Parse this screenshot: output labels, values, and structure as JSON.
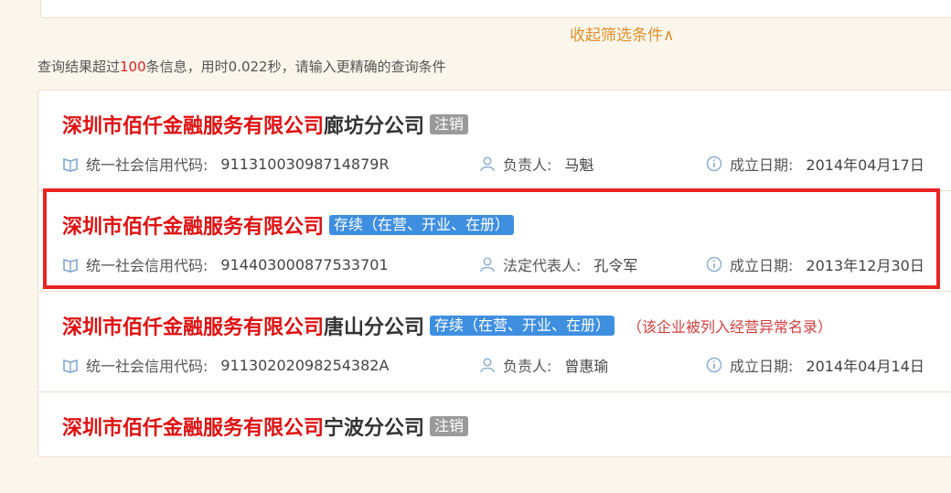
{
  "filter": {
    "collapse_label": "收起筛选条件∧"
  },
  "summary": {
    "prefix": "查询结果超过",
    "count": "100",
    "suffix": "条信息，用时0.022秒，请输入更精确的查询条件"
  },
  "results": [
    {
      "name_main": "深圳市佰仟金融服务有限公司",
      "name_branch": "廊坊分公司",
      "status": "注销",
      "status_color": "#9a9a9a",
      "note": "",
      "code_label": "统一社会信用代码:",
      "code": "91131003098714879R",
      "person_label": "负责人:",
      "person": "马魁",
      "date_label": "成立日期:",
      "date": "2014年04月17日"
    },
    {
      "name_main": "深圳市佰仟金融服务有限公司",
      "name_branch": "",
      "status": "存续（在营、开业、在册）",
      "status_color": "#3f8fe0",
      "note": "",
      "code_label": "统一社会信用代码:",
      "code": "914403000877533701",
      "person_label": "法定代表人:",
      "person": "孔令军",
      "date_label": "成立日期:",
      "date": "2013年12月30日"
    },
    {
      "name_main": "深圳市佰仟金融服务有限公司",
      "name_branch": "唐山分公司",
      "status": "存续（在营、开业、在册）",
      "status_color": "#3f8fe0",
      "note": "（该企业被列入经营异常名录）",
      "code_label": "统一社会信用代码:",
      "code": "91130202098254382A",
      "person_label": "负责人:",
      "person": "曾惠瑜",
      "date_label": "成立日期:",
      "date": "2014年04月14日"
    },
    {
      "name_main": "深圳市佰仟金融服务有限公司",
      "name_branch": "宁波分公司",
      "status": "注销",
      "status_color": "#9a9a9a",
      "note": ""
    }
  ],
  "icons": {
    "code": "book-icon",
    "person": "user-icon",
    "date": "info-icon"
  }
}
